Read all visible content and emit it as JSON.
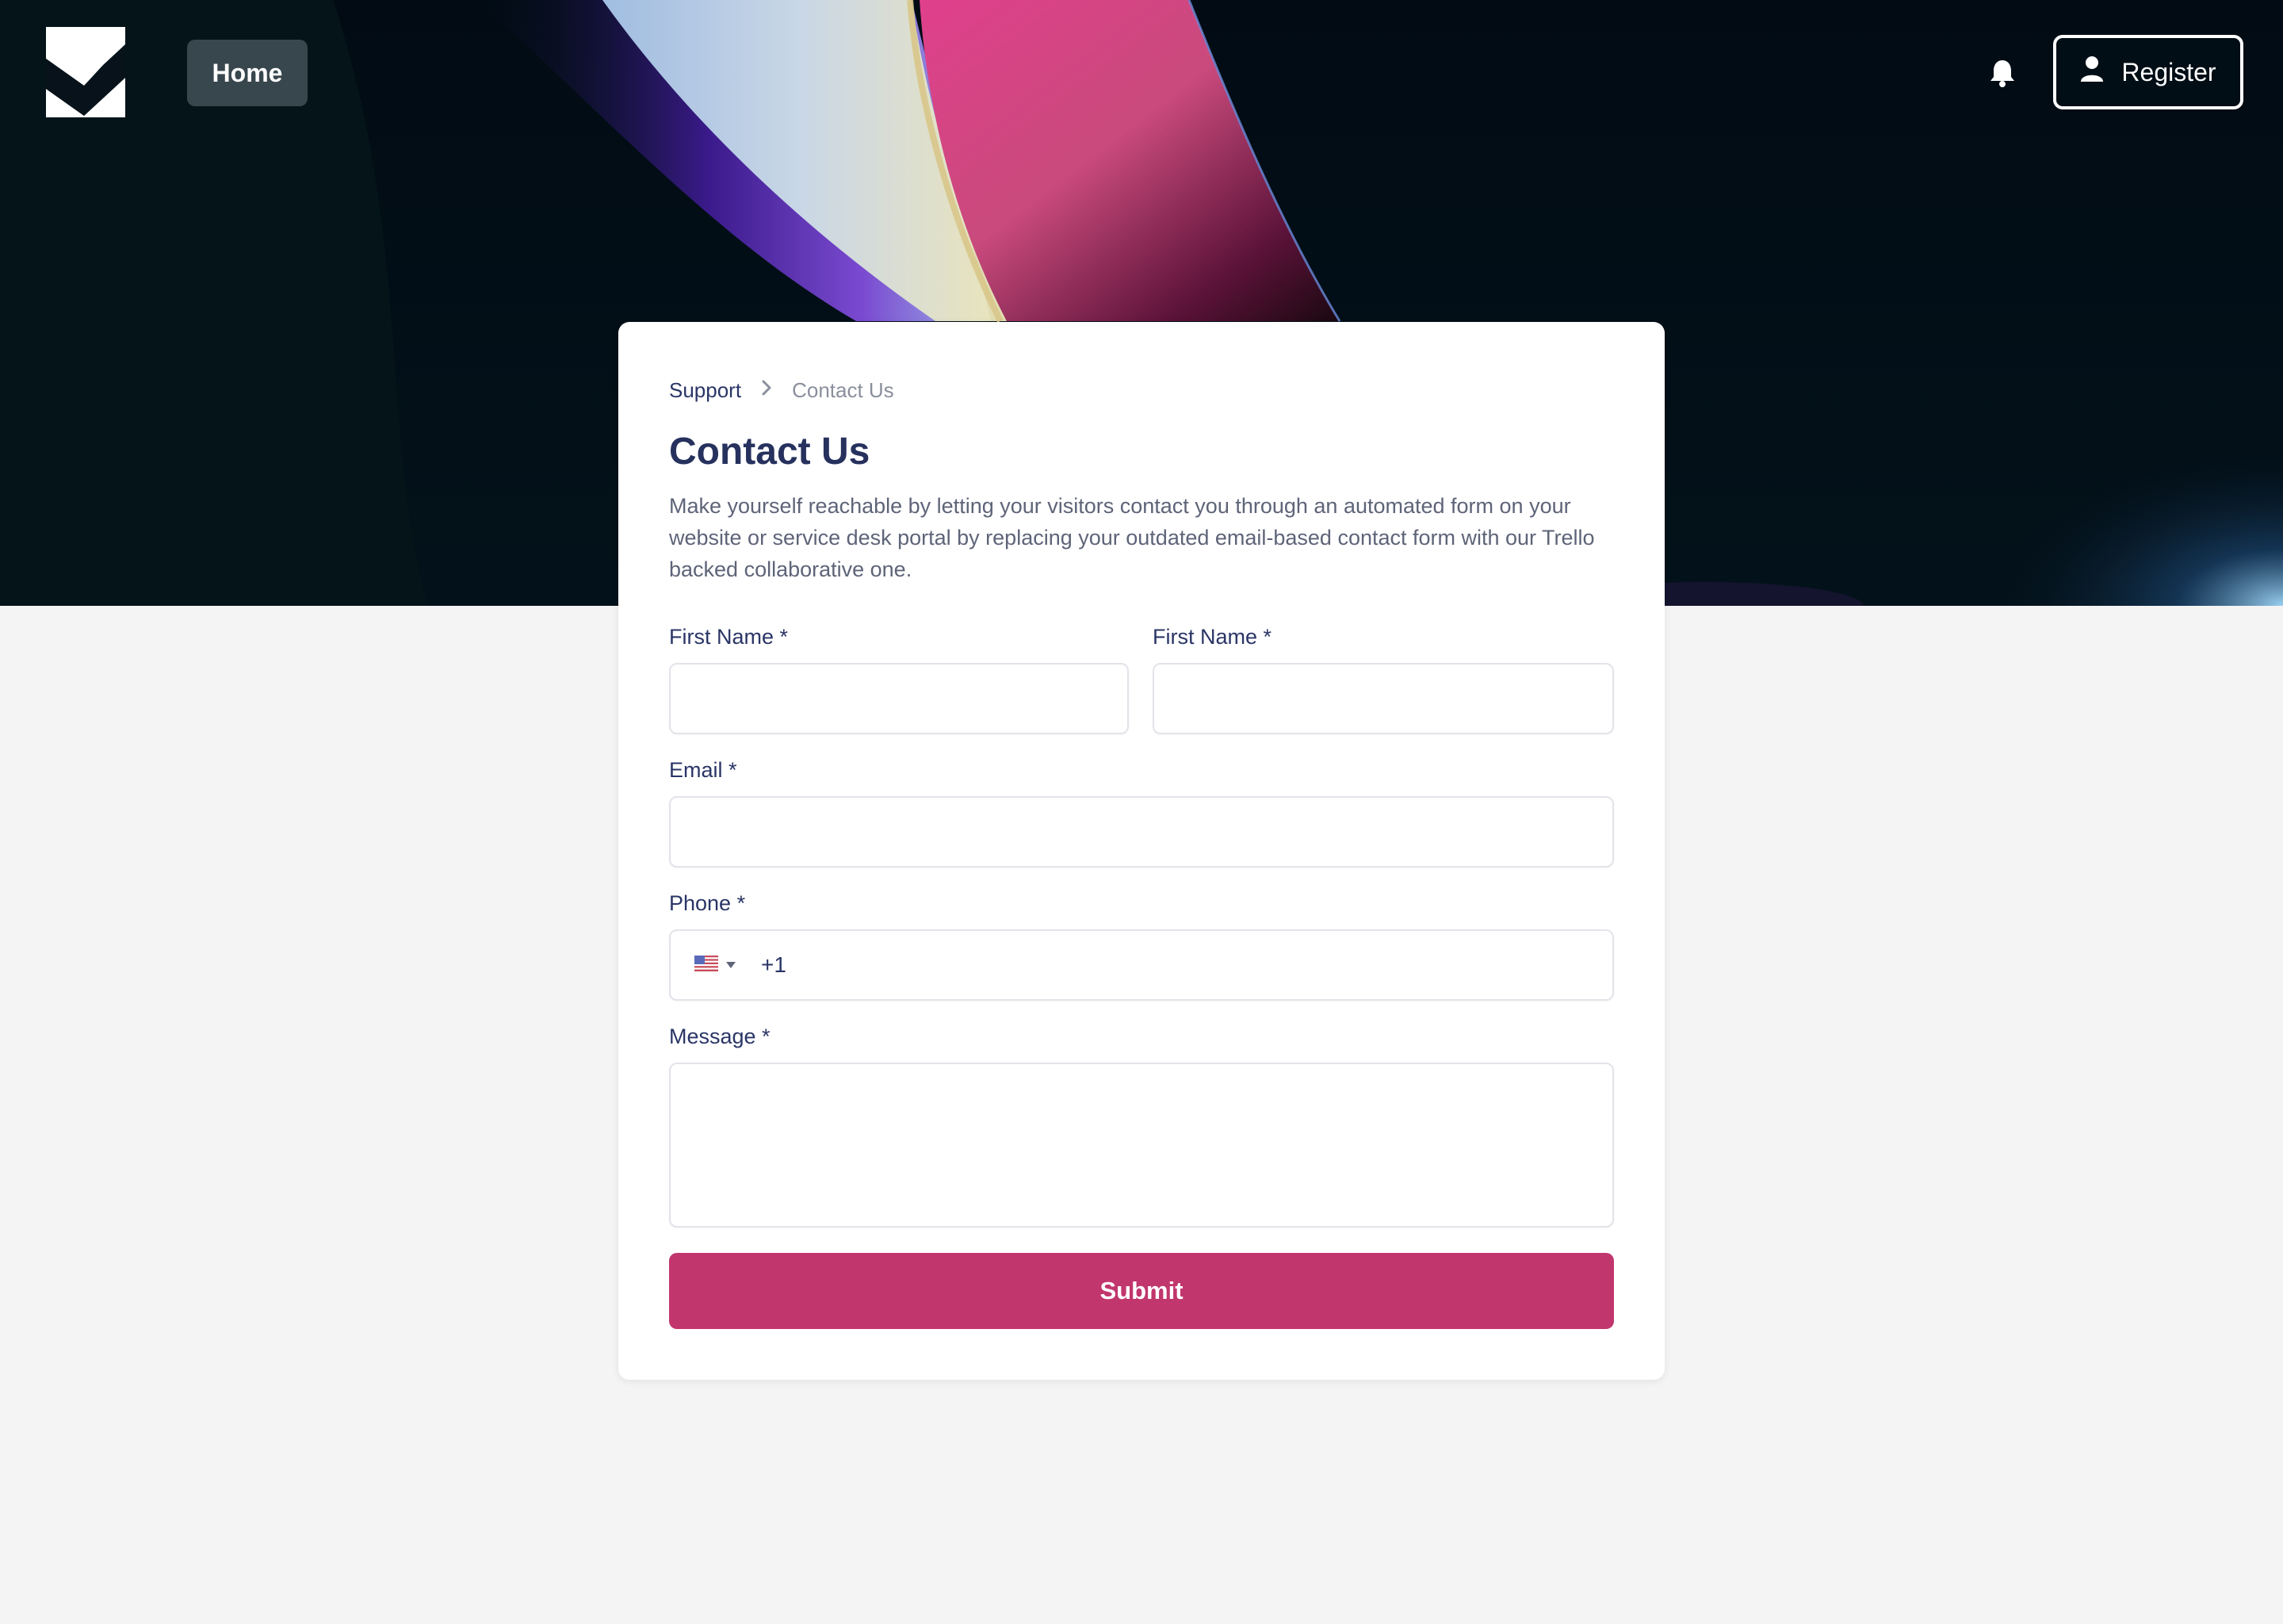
{
  "header": {
    "home_label": "Home",
    "register_label": "Register",
    "icons": {
      "logo": "brand-logo",
      "bell": "bell-icon",
      "user": "user-icon"
    }
  },
  "breadcrumb": {
    "parent": "Support",
    "current": "Contact Us"
  },
  "form": {
    "title": "Contact Us",
    "description": "Make yourself reachable by letting your visitors contact you through an automated form on your website or service desk portal by replacing your outdated email-based contact form with our Trello backed collaborative one.",
    "first_name_label": "First Name *",
    "second_name_label": "First Name *",
    "first_name_value": "",
    "second_name_value": "",
    "email_label": "Email *",
    "email_value": "",
    "phone_label": "Phone *",
    "phone_country": "US",
    "phone_code": "+1",
    "message_label": "Message *",
    "message_value": "",
    "submit_label": "Submit"
  },
  "colors": {
    "accent": "#c1366d",
    "heading": "#26315d",
    "page_background": "#f4f4f4",
    "hero_background": "#020b14"
  }
}
